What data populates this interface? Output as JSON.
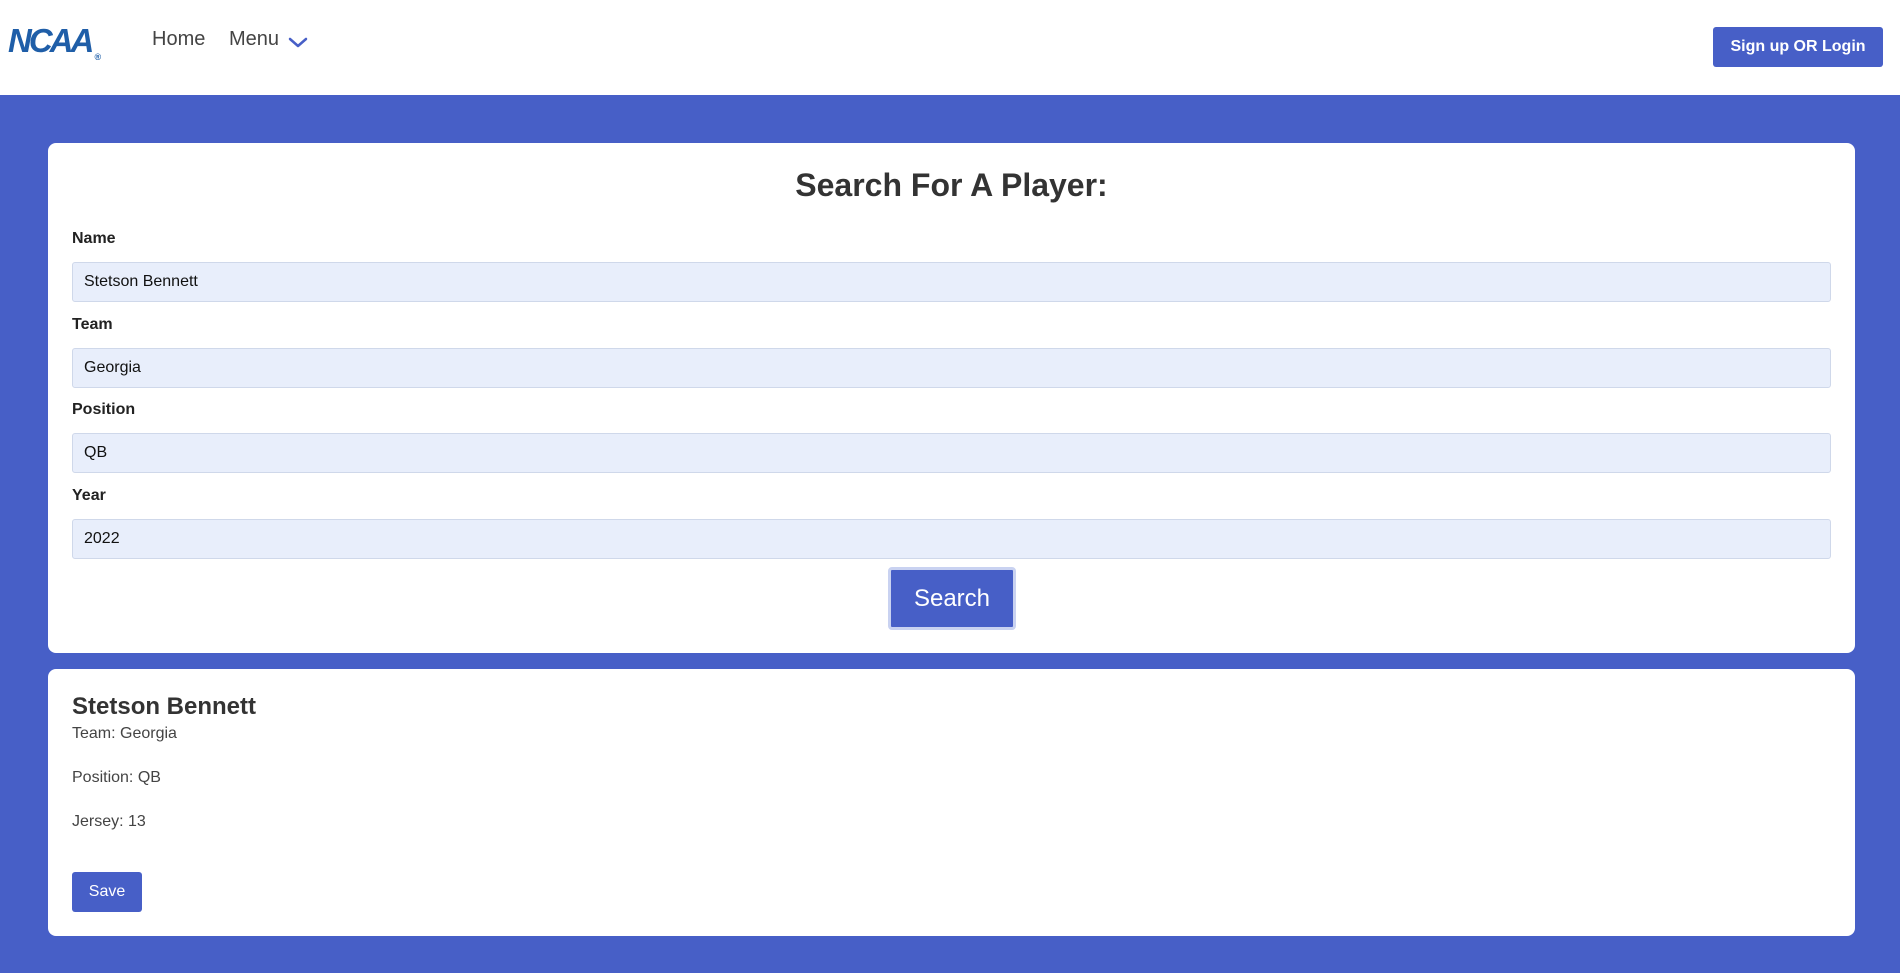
{
  "header": {
    "logo_text": "NCAA",
    "logo_mark": "®",
    "nav": {
      "home": "Home",
      "menu": "Menu"
    },
    "auth_button": "Sign up OR Login"
  },
  "search": {
    "title": "Search For A Player:",
    "fields": {
      "name": {
        "label": "Name",
        "value": "Stetson Bennett"
      },
      "team": {
        "label": "Team",
        "value": "Georgia"
      },
      "position": {
        "label": "Position",
        "value": "QB"
      },
      "year": {
        "label": "Year",
        "value": "2022"
      }
    },
    "button": "Search"
  },
  "result": {
    "name": "Stetson Bennett",
    "team": "Team: Georgia",
    "position": "Position: QB",
    "jersey": "Jersey: 13",
    "save_button": "Save"
  },
  "colors": {
    "brand": "#475fc7",
    "logo": "#1f5ea8",
    "input_bg": "#e8eefb"
  },
  "icons": {
    "menu_toggle": "chevron-down-icon"
  }
}
